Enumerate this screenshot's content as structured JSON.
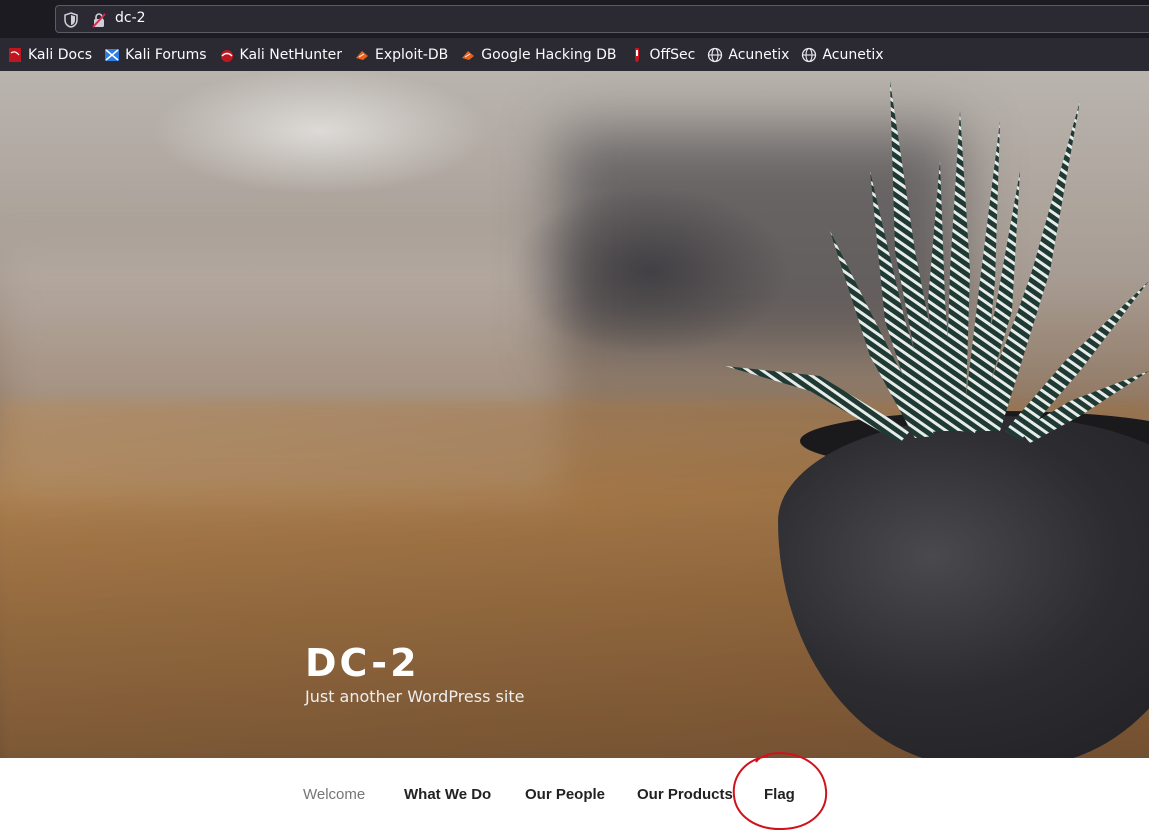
{
  "browser": {
    "url": "dc-2",
    "bookmarks": [
      {
        "label": "Kali Docs",
        "icon": "kali-docs-icon"
      },
      {
        "label": "Kali Forums",
        "icon": "kali-forums-icon"
      },
      {
        "label": "Kali NetHunter",
        "icon": "kali-nethunter-icon"
      },
      {
        "label": "Exploit-DB",
        "icon": "exploit-db-icon"
      },
      {
        "label": "Google Hacking DB",
        "icon": "google-hacking-db-icon"
      },
      {
        "label": "OffSec",
        "icon": "offsec-icon"
      },
      {
        "label": "Acunetix",
        "icon": "globe-icon"
      },
      {
        "label": "Acunetix",
        "icon": "globe-icon"
      }
    ]
  },
  "site": {
    "title": "DC-2",
    "description": "Just another WordPress site"
  },
  "nav": {
    "items": [
      {
        "label": "Welcome",
        "active": true
      },
      {
        "label": "What We Do",
        "active": false
      },
      {
        "label": "Our People",
        "active": false
      },
      {
        "label": "Our Products",
        "active": false
      },
      {
        "label": "Flag",
        "active": false
      }
    ]
  },
  "colors": {
    "annotation_circle": "#d0121b",
    "chrome_bg": "#1c1b22",
    "bookmarks_bg": "#2b2a33"
  }
}
